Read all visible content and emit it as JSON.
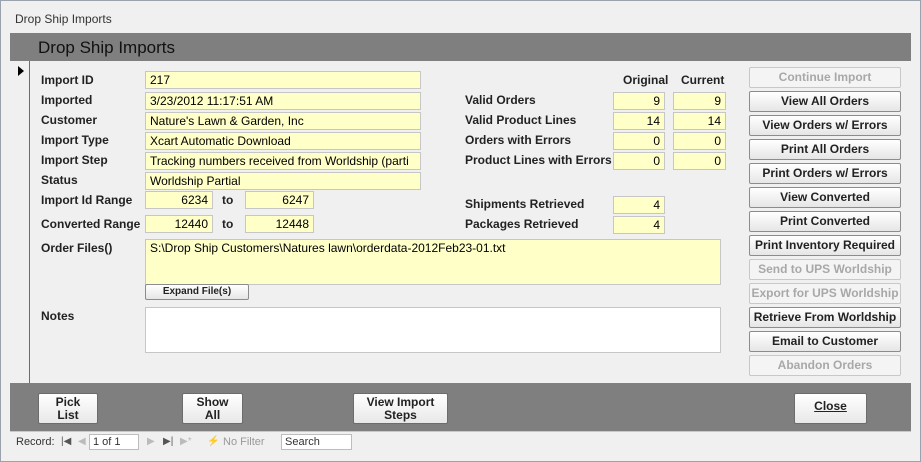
{
  "window": {
    "title": "Drop Ship Imports"
  },
  "form": {
    "title": "Drop Ship Imports"
  },
  "fields": {
    "import_id": {
      "label": "Import ID",
      "value": "217"
    },
    "imported": {
      "label": "Imported",
      "value": "3/23/2012 11:17:51 AM"
    },
    "customer": {
      "label": "Customer",
      "value": "Nature's Lawn & Garden, Inc"
    },
    "import_type": {
      "label": "Import Type",
      "value": "Xcart Automatic Download"
    },
    "import_step": {
      "label": "Import Step",
      "value": "Tracking numbers received from Worldship (parti"
    },
    "status": {
      "label": "Status",
      "value": "Worldship Partial"
    },
    "import_id_range": {
      "label": "Import Id Range",
      "from": "6234",
      "to_label": "to",
      "to": "6247"
    },
    "converted_range": {
      "label": "Converted Range",
      "from": "12440",
      "to_label": "to",
      "to": "12448"
    },
    "order_files": {
      "label": "Order Files()",
      "value": "S:\\Drop Ship Customers\\Natures lawn\\orderdata-2012Feb23-01.txt"
    },
    "expand_files_label": "Expand File(s)",
    "notes": {
      "label": "Notes",
      "value": ""
    }
  },
  "stats": {
    "col_original": "Original",
    "col_current": "Current",
    "rows": [
      {
        "label": "Valid Orders",
        "original": "9",
        "current": "9"
      },
      {
        "label": "Valid Product Lines",
        "original": "14",
        "current": "14"
      },
      {
        "label": "Orders with Errors",
        "original": "0",
        "current": "0"
      },
      {
        "label": "Product Lines with Errors",
        "original": "0",
        "current": "0"
      }
    ],
    "shipments": {
      "label": "Shipments Retrieved",
      "value": "4"
    },
    "packages": {
      "label": "Packages Retrieved",
      "value": "4"
    }
  },
  "actions": [
    {
      "label": "Continue Import",
      "enabled": false
    },
    {
      "label": "View All Orders",
      "enabled": true
    },
    {
      "label": "View Orders w/ Errors",
      "enabled": true
    },
    {
      "label": "Print All Orders",
      "enabled": true
    },
    {
      "label": "Print Orders w/ Errors",
      "enabled": true
    },
    {
      "label": "View Converted",
      "enabled": true
    },
    {
      "label": "Print Converted",
      "enabled": true
    },
    {
      "label": "Print Inventory Required",
      "enabled": true
    },
    {
      "label": "Send to UPS Worldship",
      "enabled": false
    },
    {
      "label": "Export for UPS Worldship",
      "enabled": false
    },
    {
      "label": "Retrieve From Worldship",
      "enabled": true
    },
    {
      "label": "Email to Customer",
      "enabled": true
    },
    {
      "label": "Abandon Orders",
      "enabled": false
    }
  ],
  "footer": {
    "pick_list": "Pick\nList",
    "show_all": "Show\nAll",
    "view_import_steps": "View Import\nSteps",
    "close": "Close"
  },
  "navigation": {
    "record_label": "Record:",
    "position": "1 of 1",
    "filter": "No Filter",
    "search": "Search"
  }
}
